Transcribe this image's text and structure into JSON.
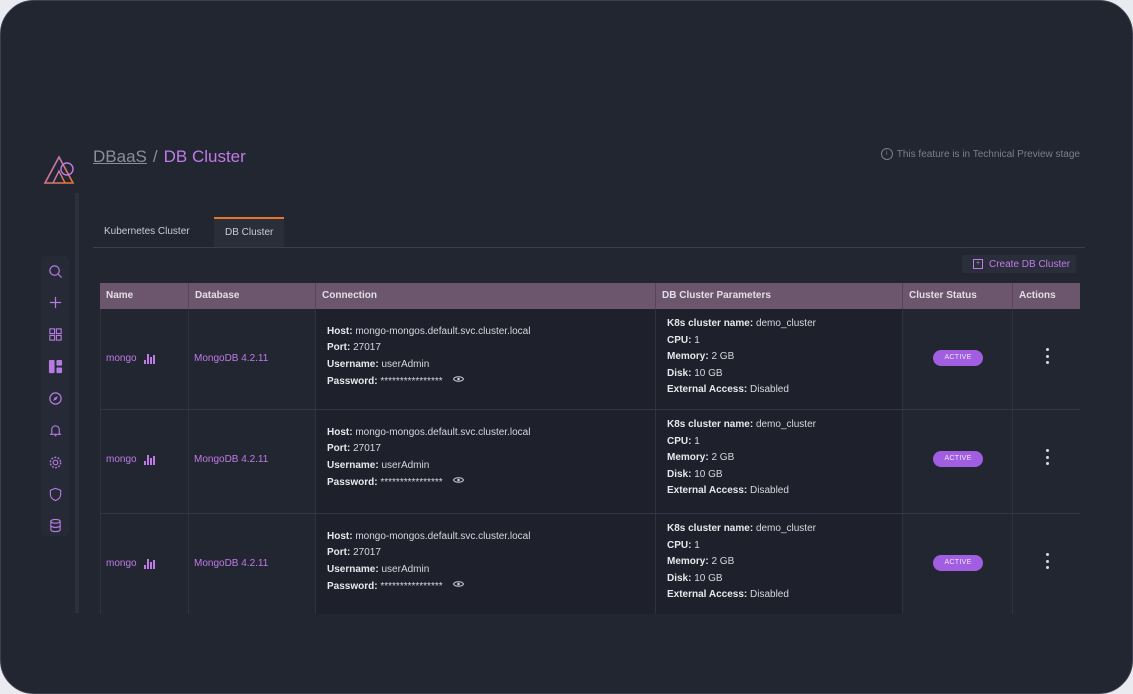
{
  "breadcrumb": {
    "parent": "DBaaS",
    "separator": "/",
    "current": "DB Cluster"
  },
  "preview_note": "This feature is in Technical Preview stage",
  "tabs": [
    {
      "label": "Kubernetes Cluster"
    },
    {
      "label": "DB Cluster"
    }
  ],
  "create_button": {
    "label": "Create DB Cluster"
  },
  "columns": [
    "Name",
    "Database",
    "Connection",
    "DB Cluster Parameters",
    "Cluster Status",
    "Actions"
  ],
  "rows": [
    {
      "name": "mongo",
      "database": "MongoDB 4.2.11",
      "host_label": "Host:",
      "host": "mongo-mongos.default.svc.cluster.local",
      "port_label": "Port:",
      "port": "27017",
      "username_label": "Username:",
      "username": "userAdmin",
      "password_label": "Password:",
      "password": "****************",
      "k8s_label": "K8s cluster name:",
      "k8s": "demo_cluster",
      "cpu_label": "CPU:",
      "cpu": "1",
      "memory_label": "Memory:",
      "memory": "2 GB",
      "disk_label": "Disk:",
      "disk": "10 GB",
      "access_label": "External Access:",
      "access": "Disabled",
      "status": "ACTIVE"
    },
    {
      "name": "mongo",
      "database": "MongoDB 4.2.11",
      "host_label": "Host:",
      "host": "mongo-mongos.default.svc.cluster.local",
      "port_label": "Port:",
      "port": "27017",
      "username_label": "Username:",
      "username": "userAdmin",
      "password_label": "Password:",
      "password": "****************",
      "k8s_label": "K8s cluster name:",
      "k8s": "demo_cluster",
      "cpu_label": "CPU:",
      "cpu": "1",
      "memory_label": "Memory:",
      "memory": "2 GB",
      "disk_label": "Disk:",
      "disk": "10 GB",
      "access_label": "External Access:",
      "access": "Disabled",
      "status": "ACTIVE"
    },
    {
      "name": "mongo",
      "database": "MongoDB 4.2.11",
      "host_label": "Host:",
      "host": "mongo-mongos.default.svc.cluster.local",
      "port_label": "Port:",
      "port": "27017",
      "username_label": "Username:",
      "username": "userAdmin",
      "password_label": "Password:",
      "password": "****************",
      "k8s_label": "K8s cluster name:",
      "k8s": "demo_cluster",
      "cpu_label": "CPU:",
      "cpu": "1",
      "memory_label": "Memory:",
      "memory": "2 GB",
      "disk_label": "Disk:",
      "disk": "10 GB",
      "access_label": "External Access:",
      "access": "Disabled",
      "status": "ACTIVE"
    }
  ],
  "nav_icons": [
    "search-icon",
    "plus-icon",
    "dashboard-grid-icon",
    "dashboards-icon",
    "compass-icon",
    "bell-icon",
    "gear-icon",
    "shield-icon",
    "database-icon"
  ],
  "colors": {
    "accent": "#c07ae8",
    "header": "#6b566e",
    "badge": "#a15ee0",
    "tab_indicator": "#e8762a",
    "background": "#222631"
  }
}
